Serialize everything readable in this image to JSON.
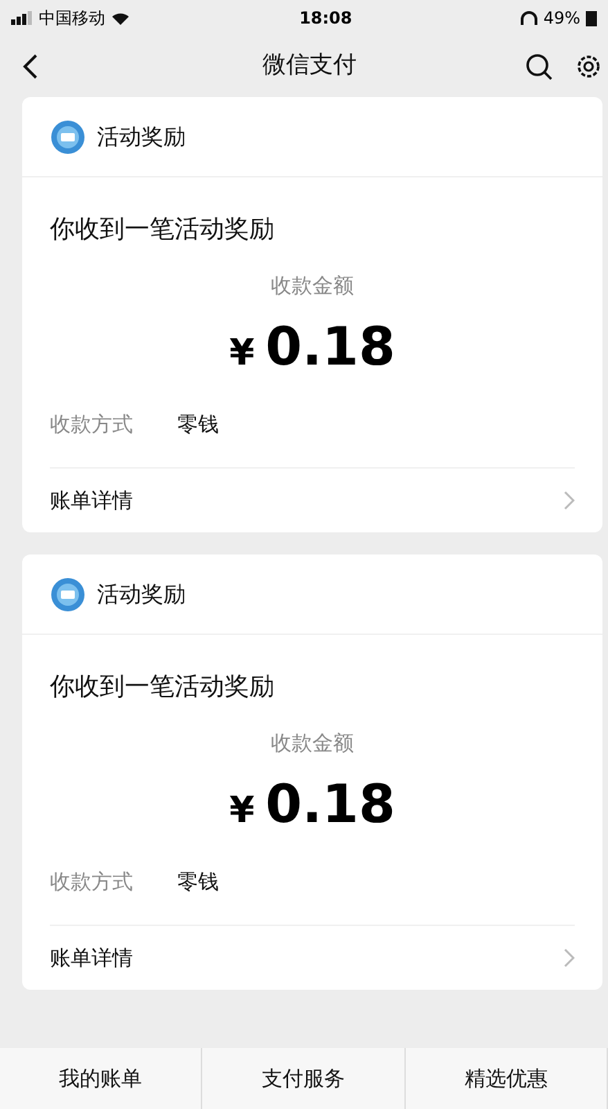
{
  "status_bar": {
    "carrier": "中国移动",
    "time": "18:08",
    "battery": "49%"
  },
  "nav": {
    "title": "微信支付"
  },
  "cards": [
    {
      "source": "活动奖励",
      "message": "你收到一笔活动奖励",
      "amount_label": "收款金额",
      "currency": "¥",
      "amount": "0.18",
      "method_label": "收款方式",
      "method": "零钱",
      "details": "账单详情"
    },
    {
      "source": "活动奖励",
      "message": "你收到一笔活动奖励",
      "amount_label": "收款金额",
      "currency": "¥",
      "amount": "0.18",
      "method_label": "收款方式",
      "method": "零钱",
      "details": "账单详情"
    }
  ],
  "tab_bar": [
    {
      "label": "我的账单"
    },
    {
      "label": "支付服务"
    },
    {
      "label": "精选优惠"
    }
  ]
}
